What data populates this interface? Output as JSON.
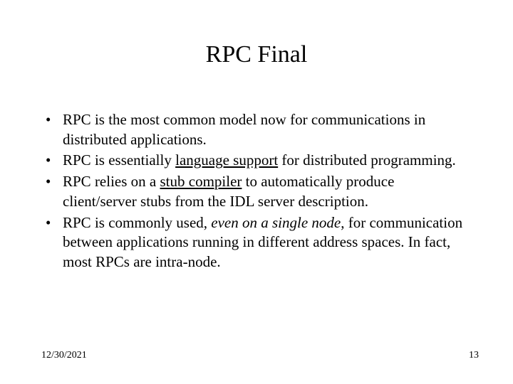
{
  "title": "RPC Final",
  "bullets": [
    {
      "pre": "RPC is the most common model now for communications in distributed applications.",
      "u": "",
      "mid": "",
      "i": "",
      "post": ""
    },
    {
      "pre": "RPC is essentially ",
      "u": "language support",
      "mid": " for distributed programming.",
      "i": "",
      "post": ""
    },
    {
      "pre": "RPC relies on a ",
      "u": "stub compiler",
      "mid": " to automatically produce client/server stubs from the IDL server description.",
      "i": "",
      "post": ""
    },
    {
      "pre": "RPC is commonly used, ",
      "u": "",
      "mid": "",
      "i": "even on a single node",
      "post": ", for communication between applications running in different address spaces.  In fact, most RPCs are intra-node."
    }
  ],
  "footer": {
    "date": "12/30/2021",
    "page": "13"
  }
}
